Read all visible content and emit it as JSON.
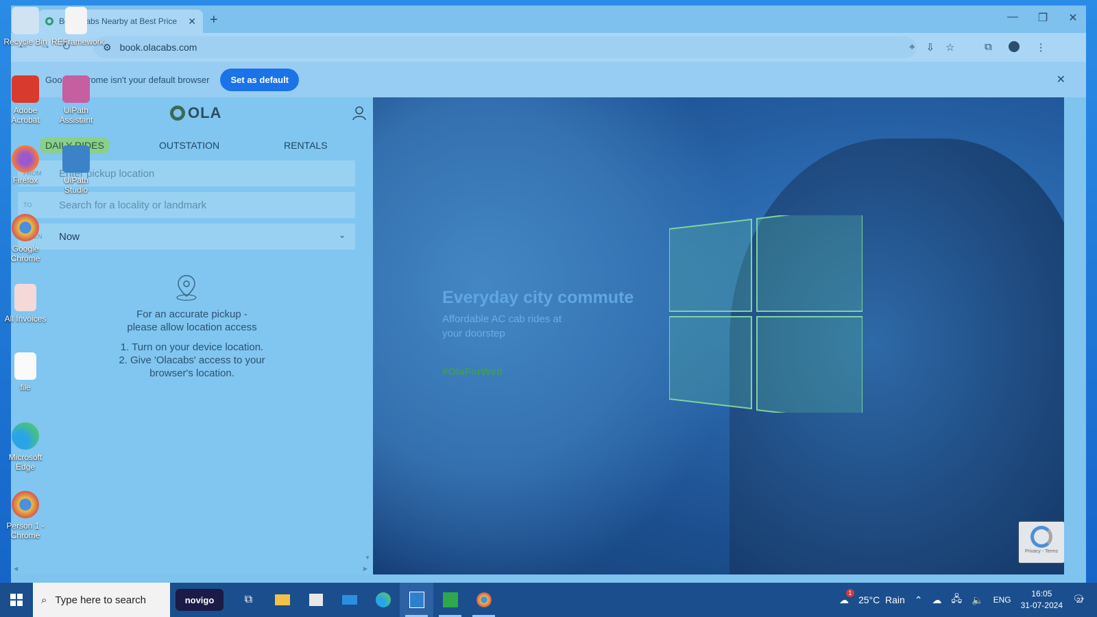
{
  "browser": {
    "tab_title": "Book Cabs Nearby at Best Price",
    "url": "book.olacabs.com",
    "infobar_text": "Google Chrome isn't your default browser",
    "set_default_label": "Set as default"
  },
  "ola": {
    "logo_text": "OLA",
    "tabs": [
      {
        "label": "DAILY RIDES",
        "active": true
      },
      {
        "label": "OUTSTATION",
        "active": false
      },
      {
        "label": "RENTALS",
        "active": false
      }
    ],
    "fields": {
      "from_label": "FROM",
      "from_placeholder": "Enter pickup location",
      "to_label": "TO",
      "to_placeholder": "Search for a locality or landmark",
      "when_label": "WHEN",
      "when_value": "Now"
    },
    "location_prompt_1": "For an accurate pickup -",
    "location_prompt_2": "please allow location access",
    "step_1": "1. Turn on your device location.",
    "step_2a": "2. Give 'Olacabs' access to your",
    "step_2b": "browser's location."
  },
  "hero": {
    "title": "Everyday city commute",
    "subtitle_1": "Affordable AC cab rides at",
    "subtitle_2": "your doorstep",
    "hashtag": "#OlaForWeb",
    "recaptcha_text": "Privacy - Terms"
  },
  "desktop_icons": [
    {
      "label": "Recycle Bin",
      "icon": "recycle-bin-icon"
    },
    {
      "label": "REFramework",
      "icon": "document-icon"
    },
    {
      "label": "Adobe Acrobat",
      "icon": "acrobat-icon"
    },
    {
      "label": "UiPath Assistant",
      "icon": "uipath-assistant-icon"
    },
    {
      "label": "Firefox",
      "icon": "firefox-icon"
    },
    {
      "label": "UiPath Studio",
      "icon": "uipath-studio-icon"
    },
    {
      "label": "Google Chrome",
      "icon": "chrome-icon"
    },
    {
      "label": "All Invoices",
      "icon": "folder-icon"
    },
    {
      "label": "file",
      "icon": "text-file-icon"
    },
    {
      "label": "Microsoft Edge",
      "icon": "edge-icon"
    },
    {
      "label": "Person 1 - Chrome",
      "icon": "chrome-profile-icon"
    }
  ],
  "taskbar": {
    "search_placeholder": "Type here to search",
    "novigo_label": "novigo",
    "weather": "25°C  Rain",
    "weather_badge": "1",
    "language": "ENG",
    "time": "16:05",
    "date": "31-07-2024",
    "notification_count": "27"
  },
  "colors": {
    "chrome_blue": "#1a73e8",
    "ola_green": "#8ad08a",
    "taskbar": "#1b4e8c"
  }
}
